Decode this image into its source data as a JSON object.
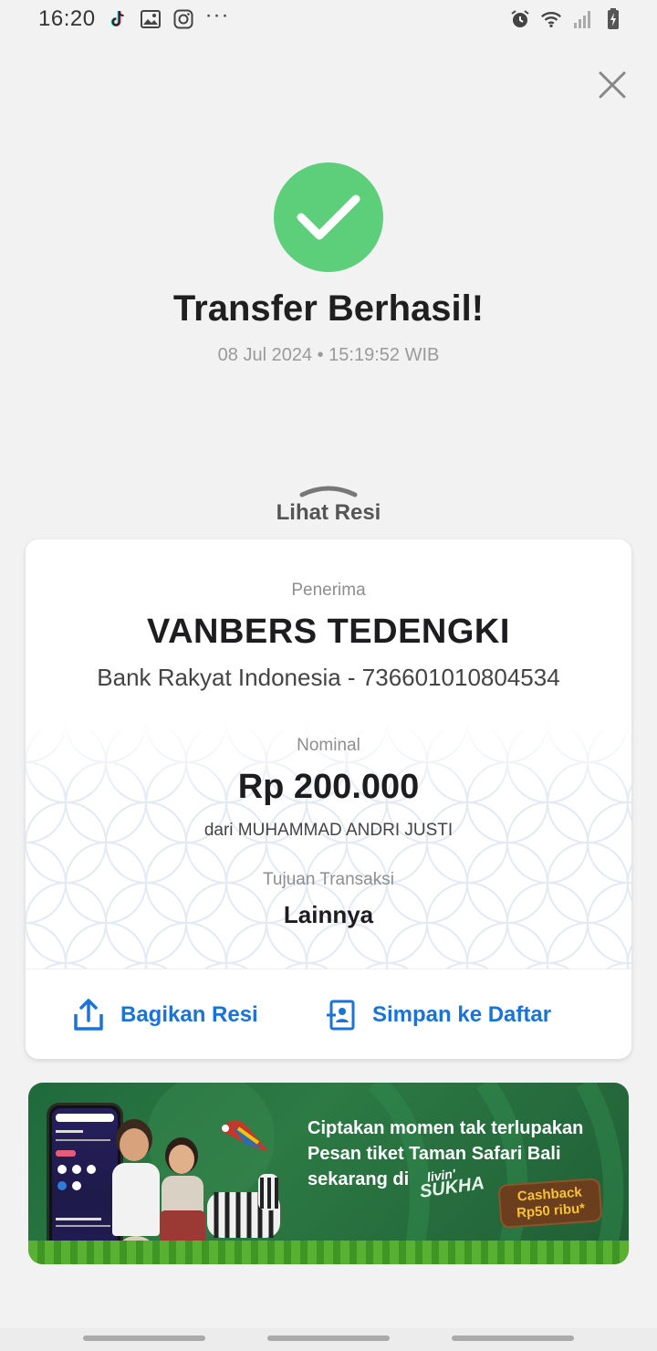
{
  "status_bar": {
    "time": "16:20",
    "left_icons": [
      "tiktok-icon",
      "gallery-icon",
      "instagram-icon"
    ],
    "more": "···",
    "right_icons": [
      "alarm-icon",
      "wifi-icon",
      "signal-icon",
      "battery-charging-icon"
    ]
  },
  "header": {
    "close_icon": "close-icon"
  },
  "success": {
    "icon": "check-icon",
    "icon_color": "#5dcf7a",
    "title": "Transfer Berhasil!",
    "datetime": "08 Jul 2024 • 15:19:52 WIB"
  },
  "resi_toggle": {
    "label": "Lihat Resi"
  },
  "receipt": {
    "recipient_label": "Penerima",
    "recipient_name": "VANBERS TEDENGKI",
    "recipient_bank": "Bank Rakyat Indonesia - 736601010804534",
    "amount_label": "Nominal",
    "amount": "Rp 200.000",
    "from": "dari MUHAMMAD ANDRI JUSTI",
    "purpose_label": "Tujuan Transaksi",
    "purpose": "Lainnya"
  },
  "actions": {
    "share_label": "Bagikan Resi",
    "save_label": "Simpan ke Daftar",
    "accent": "#1a73d9"
  },
  "banner": {
    "line1": "Ciptakan momen tak terlupakan",
    "line2": "Pesan tiket Taman Safari Bali",
    "line3": "sekarang di",
    "logo_small": "livin'",
    "logo_big": "SUKHA",
    "cashback_line1": "Cashback",
    "cashback_line2": "Rp50 ribu*"
  }
}
